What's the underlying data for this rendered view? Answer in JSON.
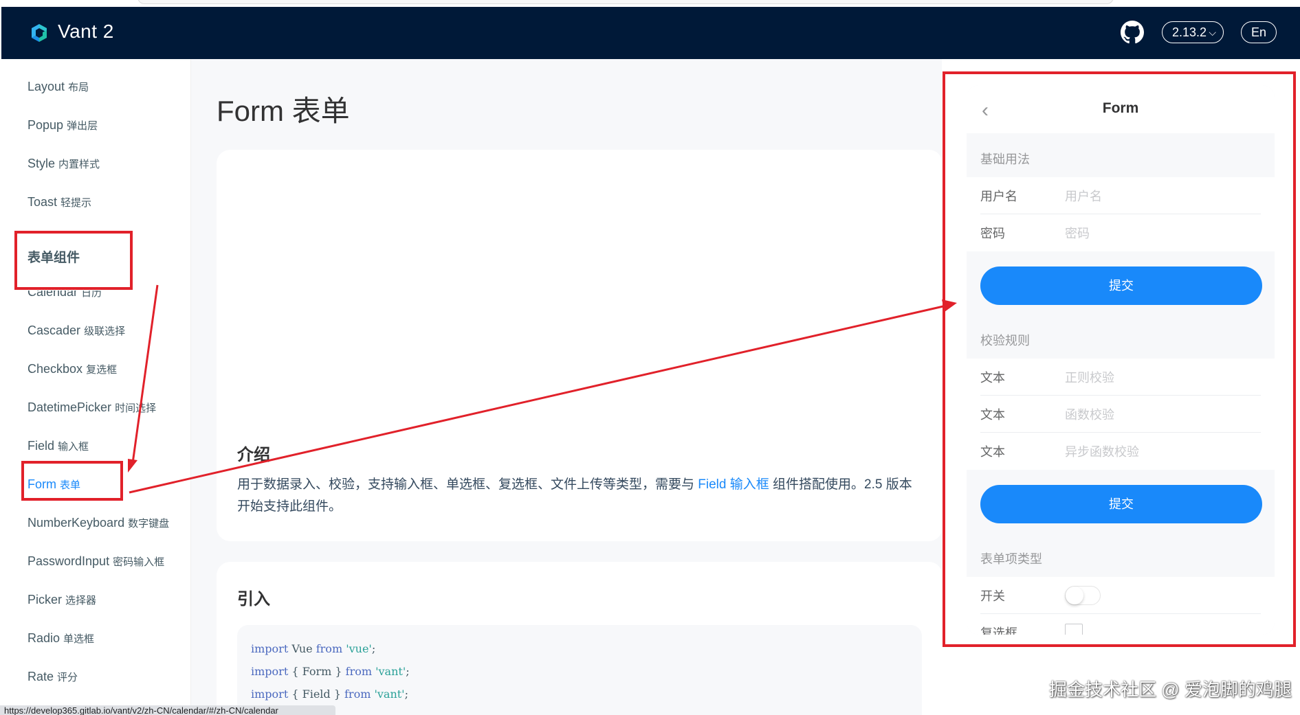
{
  "header": {
    "brand": "Vant 2",
    "version": "2.13.2",
    "version_chevron": "⌵",
    "lang": "En"
  },
  "sidebar": {
    "items": [
      {
        "en": "Layout",
        "zh": "布局"
      },
      {
        "en": "Popup",
        "zh": "弹出层"
      },
      {
        "en": "Style",
        "zh": "内置样式"
      },
      {
        "en": "Toast",
        "zh": "轻提示"
      },
      {
        "en": "Calendar",
        "zh": "日历"
      },
      {
        "en": "Cascader",
        "zh": "级联选择"
      },
      {
        "en": "Checkbox",
        "zh": "复选框"
      },
      {
        "en": "DatetimePicker",
        "zh": "时间选择"
      },
      {
        "en": "Field",
        "zh": "输入框"
      },
      {
        "en": "Form",
        "zh": "表单"
      },
      {
        "en": "NumberKeyboard",
        "zh": "数字键盘"
      },
      {
        "en": "PasswordInput",
        "zh": "密码输入框"
      },
      {
        "en": "Picker",
        "zh": "选择器"
      },
      {
        "en": "Radio",
        "zh": "单选框"
      },
      {
        "en": "Rate",
        "zh": "评分"
      }
    ],
    "group_title": "表单组件",
    "active_index": 9
  },
  "main": {
    "title": "Form 表单",
    "intro_heading": "介绍",
    "intro_text_before": "用于数据录入、校验，支持输入框、单选框、复选框、文件上传等类型，需要与 ",
    "intro_link": "Field 输入框",
    "intro_text_after": " 组件搭配使用。2.5 版本开始支持此组件。",
    "import_heading": "引入",
    "code_lines": [
      [
        "import",
        " Vue ",
        "from",
        " 'vue'",
        ";"
      ],
      [
        "import",
        " { Form } ",
        "from",
        " 'vant'",
        ";"
      ],
      [
        "import",
        " { Field } ",
        "from",
        " 'vant'",
        ";"
      ]
    ]
  },
  "simulator": {
    "nav_title": "Form",
    "back_icon": "‹",
    "basic_title": "基础用法",
    "basic_fields": [
      {
        "label": "用户名",
        "placeholder": "用户名"
      },
      {
        "label": "密码",
        "placeholder": "密码"
      }
    ],
    "submit_label": "提交",
    "rules_title": "校验规则",
    "rules_fields": [
      {
        "label": "文本",
        "placeholder": "正则校验"
      },
      {
        "label": "文本",
        "placeholder": "函数校验"
      },
      {
        "label": "文本",
        "placeholder": "异步函数校验"
      }
    ],
    "submit_label_2": "提交",
    "types_title": "表单项类型",
    "switch_label": "开关",
    "checkbox_label": "复选框"
  },
  "status_url": "https://develop365.gitlab.io/vant/v2/zh-CN/calendar/#/zh-CN/calendar",
  "watermark": "掘金技术社区 @ 爱泡脚的鸡腿",
  "colors": {
    "header_bg": "#001938",
    "accent": "#1989fa",
    "annotation_red": "#e1212a"
  }
}
